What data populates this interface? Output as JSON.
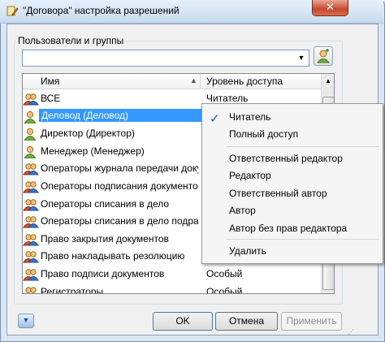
{
  "window": {
    "title": "\"Договора\" настройка разрешений",
    "close_label": "✕"
  },
  "group_label": "Пользователи и группы",
  "user_combo": {
    "value": ""
  },
  "columns": {
    "name": "Имя",
    "level": "Уровень доступа"
  },
  "rows": [
    {
      "name": "ВСЕ",
      "level": "Читатель",
      "icon": "group-icon"
    },
    {
      "name": "Деловод (Деловод)",
      "level": "",
      "icon": "user-icon",
      "selected": true
    },
    {
      "name": "Директор (Директор)",
      "level": "",
      "icon": "user-icon"
    },
    {
      "name": "Менеджер (Менеджер)",
      "level": "",
      "icon": "user-icon"
    },
    {
      "name": "Операторы журнала передачи докум...",
      "level": "",
      "icon": "group-icon"
    },
    {
      "name": "Операторы подписания документов",
      "level": "",
      "icon": "group-icon"
    },
    {
      "name": "Операторы списания в дело",
      "level": "",
      "icon": "group-icon"
    },
    {
      "name": "Операторы списания в дело подразд...",
      "level": "",
      "icon": "group-icon"
    },
    {
      "name": "Право закрытия документов",
      "level": "",
      "icon": "group-icon"
    },
    {
      "name": "Право накладывать резолюцию",
      "level": "",
      "icon": "group-icon"
    },
    {
      "name": "Право подписи документов",
      "level": "Особый",
      "icon": "group-icon"
    },
    {
      "name": "Регистраторы",
      "level": "Особый",
      "icon": "group-icon"
    }
  ],
  "context_menu": {
    "items": [
      {
        "label": "Читатель",
        "checked": true
      },
      {
        "label": "Полный доступ"
      },
      {
        "label": "Ответственный редактор"
      },
      {
        "label": "Редактор"
      },
      {
        "label": "Ответственный автор"
      },
      {
        "label": "Автор"
      },
      {
        "label": "Автор без прав редактора"
      },
      {
        "label": "Удалить"
      }
    ]
  },
  "buttons": {
    "ok": "OK",
    "cancel": "Отмена",
    "apply": "Применить"
  },
  "colors": {
    "selection": "#3399ff",
    "check": "#1a56c7"
  }
}
